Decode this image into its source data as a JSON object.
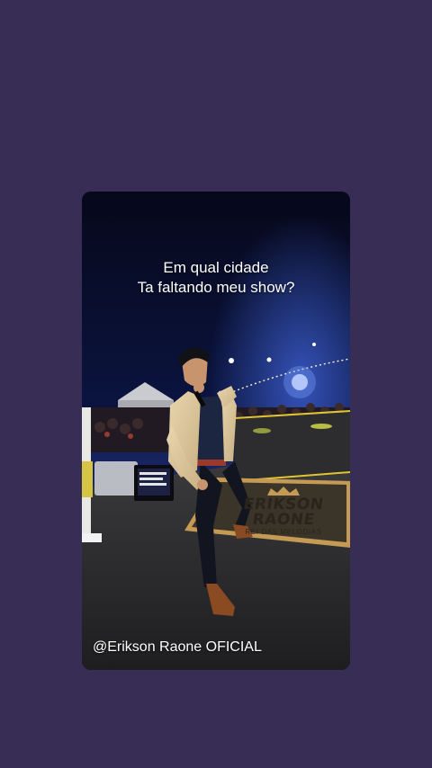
{
  "story": {
    "caption_line1": "Em qual cidade",
    "caption_line2": "Ta faltando meu show?",
    "watermark": "@Erikson Raone OFICIAL"
  },
  "banner": {
    "brand_line1": "ERIKSON",
    "brand_line2": "RAONE",
    "subtitle": "REI DAS MELODIAS"
  },
  "colors": {
    "page_background": "#372d55",
    "stage_floor": "#2b2b2e",
    "banner_gold": "#c49a55"
  },
  "icons": {
    "banner_mark": "crown-icon"
  }
}
